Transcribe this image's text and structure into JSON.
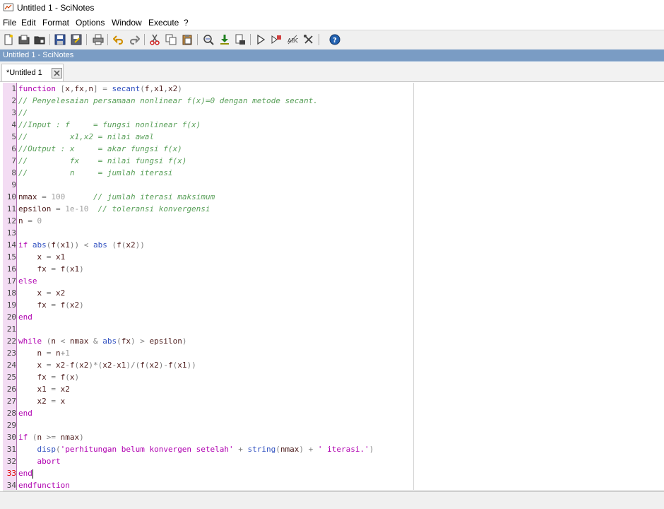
{
  "window": {
    "title": "Untitled 1 - SciNotes"
  },
  "menu": [
    "File",
    "Edit",
    "Format",
    "Options",
    "Window",
    "Execute",
    "?"
  ],
  "toolbar_icons": [
    "new-file-icon",
    "open-file-icon",
    "open-folder-icon",
    "save-icon",
    "save-as-icon",
    "print-icon",
    "undo-icon",
    "redo-icon",
    "cut-icon",
    "copy-icon",
    "paste-icon",
    "find-replace-icon",
    "execute-file-icon",
    "load-into-scilab-icon",
    "run-icon",
    "run-selection-icon",
    "abc-icon",
    "settings-icon",
    "help-icon"
  ],
  "document_bar": {
    "title": "Untitled 1 - SciNotes"
  },
  "tab": {
    "label": "*Untitled 1"
  },
  "editor": {
    "current_line": 33,
    "lines": [
      {
        "n": "1",
        "text": "function [x,fx,n] = secant(f,x1,x2)"
      },
      {
        "n": "2",
        "text": "// Penyelesaian persamaan nonlinear f(x)=0 dengan metode secant."
      },
      {
        "n": "3",
        "text": "//"
      },
      {
        "n": "4",
        "text": "//Input : f     = fungsi nonlinear f(x)"
      },
      {
        "n": "5",
        "text": "//         x1,x2 = nilai awal"
      },
      {
        "n": "6",
        "text": "//Output : x     = akar fungsi f(x)"
      },
      {
        "n": "7",
        "text": "//         fx    = nilai fungsi f(x)"
      },
      {
        "n": "8",
        "text": "//         n     = jumlah iterasi"
      },
      {
        "n": "9",
        "text": ""
      },
      {
        "n": "10",
        "text": "nmax = 100      // jumlah iterasi maksimum"
      },
      {
        "n": "11",
        "text": "epsilon = 1e-10  // toleransi konvergensi"
      },
      {
        "n": "12",
        "text": "n = 0"
      },
      {
        "n": "13",
        "text": ""
      },
      {
        "n": "14",
        "text": "if abs(f(x1)) < abs (f(x2))"
      },
      {
        "n": "15",
        "text": "    x = x1"
      },
      {
        "n": "16",
        "text": "    fx = f(x1)"
      },
      {
        "n": "17",
        "text": "else"
      },
      {
        "n": "18",
        "text": "    x = x2"
      },
      {
        "n": "19",
        "text": "    fx = f(x2)"
      },
      {
        "n": "20",
        "text": "end"
      },
      {
        "n": "21",
        "text": ""
      },
      {
        "n": "22",
        "text": "while (n < nmax & abs(fx) > epsilon)"
      },
      {
        "n": "23",
        "text": "    n = n+1"
      },
      {
        "n": "24",
        "text": "    x = x2-f(x2)*(x2-x1)/(f(x2)-f(x1))"
      },
      {
        "n": "25",
        "text": "    fx = f(x)"
      },
      {
        "n": "26",
        "text": "    x1 = x2"
      },
      {
        "n": "27",
        "text": "    x2 = x"
      },
      {
        "n": "28",
        "text": "end"
      },
      {
        "n": "29",
        "text": ""
      },
      {
        "n": "30",
        "text": "if (n >= nmax)"
      },
      {
        "n": "31",
        "text": "    disp('perhitungan belum konvergen setelah' + string(nmax) + ' iterasi.')"
      },
      {
        "n": "32",
        "text": "    abort"
      },
      {
        "n": "33",
        "text": "end"
      },
      {
        "n": "34",
        "text": "endfunction"
      }
    ]
  },
  "colors": {
    "gutter_bg": "#f3dcf3",
    "keyword": "#b000b0",
    "comment": "#5aa05a",
    "builtin": "#3050c0",
    "number": "#a0a0a0",
    "docbar": "#7a9cc4"
  }
}
